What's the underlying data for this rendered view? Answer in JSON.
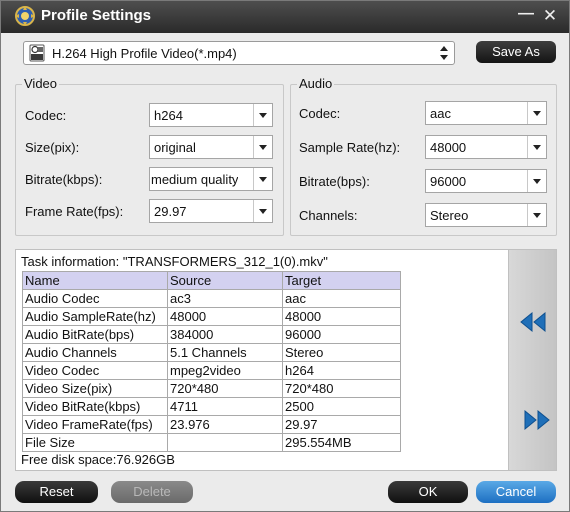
{
  "window": {
    "title": "Profile Settings"
  },
  "profile": {
    "value": "H.264 High Profile Video(*.mp4)",
    "icon_text": "MP4",
    "save_as_label": "Save As"
  },
  "video": {
    "legend": "Video",
    "fields": [
      {
        "label": "Codec:",
        "value": "h264"
      },
      {
        "label": "Size(pix):",
        "value": "original"
      },
      {
        "label": "Bitrate(kbps):",
        "value": "medium quality"
      },
      {
        "label": "Frame Rate(fps):",
        "value": "29.97"
      }
    ]
  },
  "audio": {
    "legend": "Audio",
    "fields": [
      {
        "label": "Codec:",
        "value": "aac"
      },
      {
        "label": "Sample Rate(hz):",
        "value": "48000"
      },
      {
        "label": "Bitrate(bps):",
        "value": "96000"
      },
      {
        "label": "Channels:",
        "value": "Stereo"
      }
    ]
  },
  "task": {
    "info": "Task information: \"TRANSFORMERS_312_1(0).mkv\"",
    "columns": [
      "Name",
      "Source",
      "Target"
    ],
    "rows": [
      [
        "Audio Codec",
        "ac3",
        "aac"
      ],
      [
        "Audio SampleRate(hz)",
        "48000",
        "48000"
      ],
      [
        "Audio BitRate(bps)",
        "384000",
        "96000"
      ],
      [
        "Audio Channels",
        "5.1 Channels",
        "Stereo"
      ],
      [
        "Video Codec",
        "mpeg2video",
        "h264"
      ],
      [
        "Video Size(pix)",
        "720*480",
        "720*480"
      ],
      [
        "Video BitRate(kbps)",
        "4711",
        "2500"
      ],
      [
        "Video FrameRate(fps)",
        "23.976",
        "29.97"
      ],
      [
        "File Size",
        "",
        "295.554MB"
      ]
    ],
    "free_disk": "Free disk space:76.926GB"
  },
  "buttons": {
    "reset": "Reset",
    "delete": "Delete",
    "ok": "OK",
    "cancel": "Cancel"
  },
  "colors": {
    "accent_blue": "#2a7fd4",
    "nav_arrow": "#1f6fb8",
    "table_header": "#d3d1f0"
  }
}
